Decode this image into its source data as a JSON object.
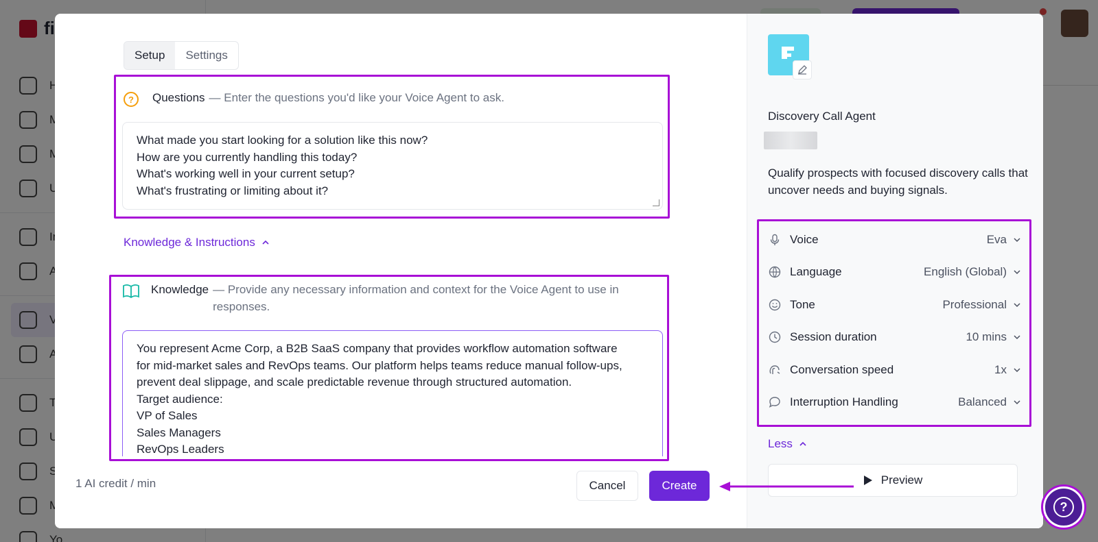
{
  "background": {
    "brand": "fi",
    "nav_items": [
      "H",
      "M",
      "M",
      "U",
      "In",
      "A",
      "V",
      "A",
      "T",
      "U",
      "S",
      "M"
    ],
    "footer_text": "Yo"
  },
  "tabs": [
    {
      "label": "Setup",
      "active": true
    },
    {
      "label": "Settings",
      "active": false
    }
  ],
  "questions": {
    "title": "Questions",
    "desc": "— Enter the questions you'd like your Voice Agent to ask.",
    "lines": [
      "What made you start looking for a solution like this now?",
      "How are you currently handling this today?",
      "What's working well in your current setup?",
      "What's frustrating or limiting about it?"
    ]
  },
  "knowledge_toggle": "Knowledge & Instructions",
  "knowledge": {
    "title": "Knowledge",
    "desc": "— Provide any necessary information and context for the Voice Agent to use in responses.",
    "lines": [
      "You represent Acme Corp, a B2B SaaS company that provides workflow automation software",
      "for mid-market sales and RevOps teams. Our platform helps teams reduce manual follow-ups,",
      "prevent deal slippage, and scale predictable revenue through structured automation.",
      "Target audience:",
      "VP of Sales",
      "Sales Managers",
      "RevOps Leaders"
    ]
  },
  "footer": {
    "credit": "1 AI credit / min",
    "cancel_label": "Cancel",
    "create_label": "Create"
  },
  "agent": {
    "name": "Discovery Call Agent",
    "description": "Qualify prospects with focused discovery calls that uncover needs and buying signals."
  },
  "settings": [
    {
      "label": "Voice",
      "value": "Eva",
      "icon": "mic-icon"
    },
    {
      "label": "Language",
      "value": "English (Global)",
      "icon": "globe-icon"
    },
    {
      "label": "Tone",
      "value": "Professional",
      "icon": "smile-icon"
    },
    {
      "label": "Session duration",
      "value": "10 mins",
      "icon": "clock-icon"
    },
    {
      "label": "Conversation speed",
      "value": "1x",
      "icon": "speed-icon"
    },
    {
      "label": "Interruption Handling",
      "value": "Balanced",
      "icon": "chat-bubble-icon"
    }
  ],
  "less_label": "Less",
  "preview_label": "Preview",
  "colors": {
    "accent": "#6d28d9",
    "highlight": "#a80fd6",
    "avatar_bg": "#5fd6ef"
  }
}
